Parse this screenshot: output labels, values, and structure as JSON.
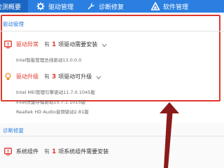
{
  "nav": {
    "tabs": [
      {
        "label": "检测概要",
        "icon": "monitor-icon",
        "active": true
      },
      {
        "label": "驱动管理",
        "icon": "gear-icon",
        "active": false
      },
      {
        "label": "诊断修复",
        "icon": "wrench-icon",
        "active": false
      },
      {
        "label": "软件管理",
        "icon": "triangle-icon",
        "active": false
      }
    ]
  },
  "driver_section": {
    "title": "驱动管理",
    "abnormal": {
      "status": "驱动异常",
      "prefix": "有",
      "count": "1",
      "suffix": "项驱动需要安装",
      "items": [
        "Intel智能管理总线驱动13.0.0.0"
      ]
    },
    "upgrade": {
      "status": "驱动升级",
      "prefix": "有",
      "count": "3",
      "suffix": "项驱动可升级",
      "items": [
        "Intel MEI管理引擎驱动11.7.0.1045版",
        "Intel快速存储驱动15.7.1.1015版",
        "Realtek HD Audio音频驱动2.81版"
      ]
    }
  },
  "repair_section": {
    "title": "诊断修复",
    "system": {
      "status": "系统组件",
      "prefix": "有",
      "count": "1",
      "suffix": "项系统组件需要安装"
    }
  },
  "colors": {
    "nav_bg": "#2a7fe0",
    "nav_active": "#1a66c2",
    "alert_red": "#e0382e",
    "upgrade_orange": "#f08a24"
  }
}
